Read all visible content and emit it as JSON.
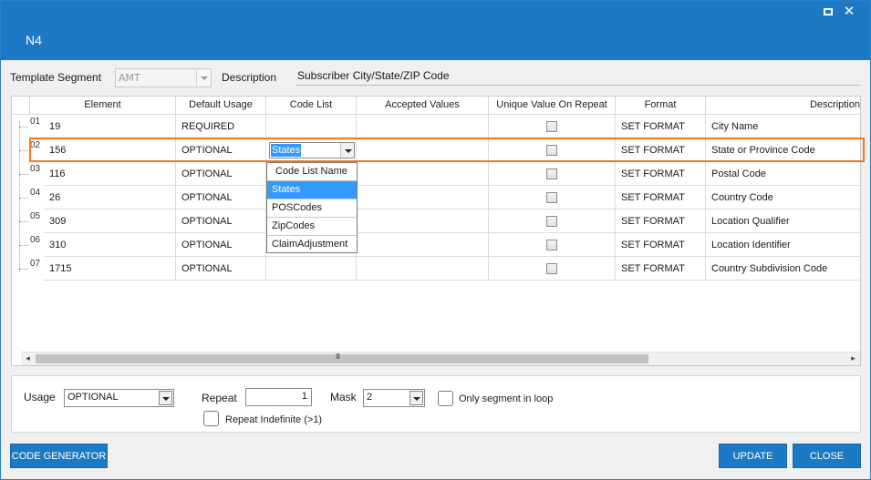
{
  "window": {
    "title": "N4",
    "controls": {
      "maximize_icon": "maximize-icon",
      "close_icon": "close-icon",
      "close_glyph": "✕"
    }
  },
  "segment": {
    "template_label": "Template Segment",
    "template_value": "AMT",
    "description_label": "Description",
    "description_value": "Subscriber City/State/ZIP Code"
  },
  "grid": {
    "columns": [
      "Element",
      "Default Usage",
      "Code List",
      "Accepted Values",
      "Unique Value On Repeat",
      "Format",
      "Description"
    ],
    "rows": [
      {
        "num": "01",
        "element": "19",
        "usage": "REQUIRED",
        "code_list": "",
        "accepted": "",
        "unique": false,
        "format": "SET FORMAT",
        "description": "City Name"
      },
      {
        "num": "02",
        "element": "156",
        "usage": "OPTIONAL",
        "code_list": "States",
        "accepted": "",
        "unique": false,
        "format": "SET FORMAT",
        "description": "State or Province Code"
      },
      {
        "num": "03",
        "element": "116",
        "usage": "OPTIONAL",
        "code_list": "",
        "accepted": "",
        "unique": false,
        "format": "SET FORMAT",
        "description": "Postal Code"
      },
      {
        "num": "04",
        "element": "26",
        "usage": "OPTIONAL",
        "code_list": "",
        "accepted": "",
        "unique": false,
        "format": "SET FORMAT",
        "description": "Country Code"
      },
      {
        "num": "05",
        "element": "309",
        "usage": "OPTIONAL",
        "code_list": "",
        "accepted": "",
        "unique": false,
        "format": "SET FORMAT",
        "description": "Location Qualifier"
      },
      {
        "num": "06",
        "element": "310",
        "usage": "OPTIONAL",
        "code_list": "",
        "accepted": "",
        "unique": false,
        "format": "SET FORMAT",
        "description": "Location Identifier"
      },
      {
        "num": "07",
        "element": "1715",
        "usage": "OPTIONAL",
        "code_list": "",
        "accepted": "",
        "unique": false,
        "format": "SET FORMAT",
        "description": "Country Subdivision Code"
      }
    ],
    "selected_row": "02",
    "code_list_dropdown": {
      "header": "Code List Name",
      "options": [
        "States",
        "POSCodes",
        "ZipCodes",
        "ClaimAdjustment"
      ],
      "highlighted": "States"
    },
    "scroll_grip": "III"
  },
  "usage_panel": {
    "usage_label": "Usage",
    "usage_value": "OPTIONAL",
    "repeat_label": "Repeat",
    "repeat_value": "1",
    "repeat_indefinite_label": "Repeat Indefinite (>1)",
    "repeat_indefinite_checked": false,
    "mask_label": "Mask",
    "mask_value": "2",
    "only_loop_label": "Only segment in loop",
    "only_loop_checked": false
  },
  "buttons": {
    "code_generator": "CODE GENERATOR",
    "update": "UPDATE",
    "close": "CLOSE"
  },
  "colors": {
    "accent": "#1e79c4",
    "selection_outline": "#f47920",
    "highlight": "#3399ff"
  }
}
